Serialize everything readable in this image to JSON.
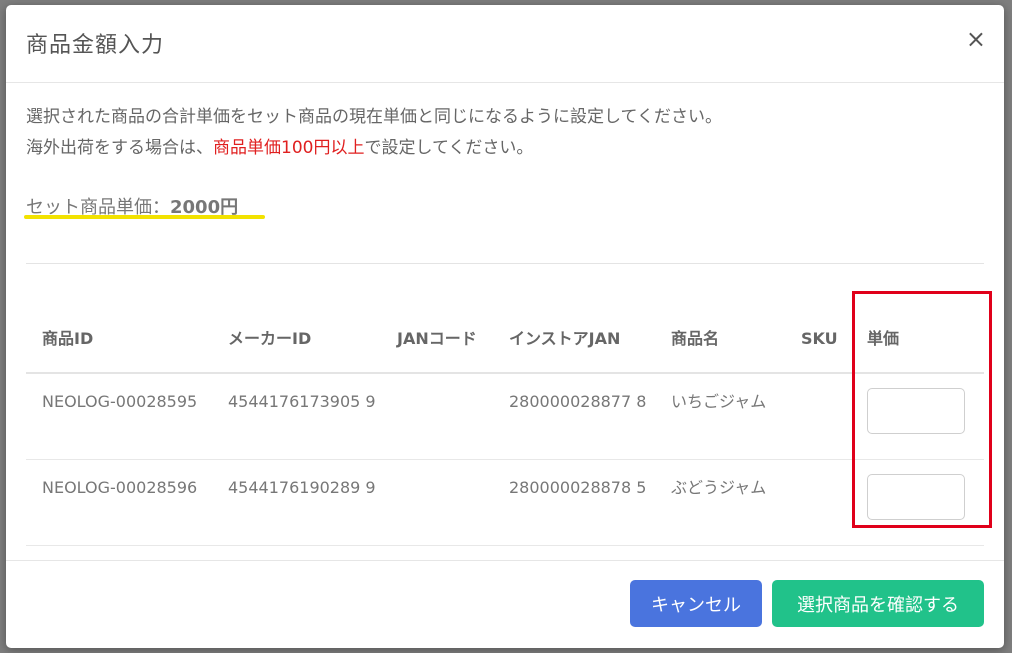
{
  "modal": {
    "title": "商品金額入力",
    "close_glyph": "×",
    "message_line1": "選択された商品の合計単価をセット商品の現在単価と同じになるように設定してください。",
    "message_line2_prefix": "海外出荷をする場合は、",
    "message_line2_highlight": "商品単価100円以上",
    "message_line2_suffix": "で設定してください。",
    "set_price_label": "セット商品単価：",
    "set_price_value": "2000円",
    "highlight_color": "#e02020"
  },
  "table": {
    "headers": {
      "product_id": "商品ID",
      "maker_id": "メーカーID",
      "jan_code": "JANコード",
      "instore_jan": "インストアJAN",
      "product_name": "商品名",
      "sku": "SKU",
      "unit_price": "単価"
    },
    "rows": [
      {
        "product_id": "NEOLOG-00028595",
        "maker_id": "4544176173905 9",
        "jan_code": "",
        "instore_jan": "280000028877 8",
        "product_name": "いちごジャム",
        "sku": "",
        "unit_price": ""
      },
      {
        "product_id": "NEOLOG-00028596",
        "maker_id": "4544176190289 9",
        "jan_code": "",
        "instore_jan": "280000028878 5",
        "product_name": "ぶどうジャム",
        "sku": "",
        "unit_price": ""
      }
    ]
  },
  "footer": {
    "cancel_label": "キャンセル",
    "confirm_label": "選択商品を確認する",
    "cancel_color": "#4a74de",
    "confirm_color": "#21c28a"
  }
}
